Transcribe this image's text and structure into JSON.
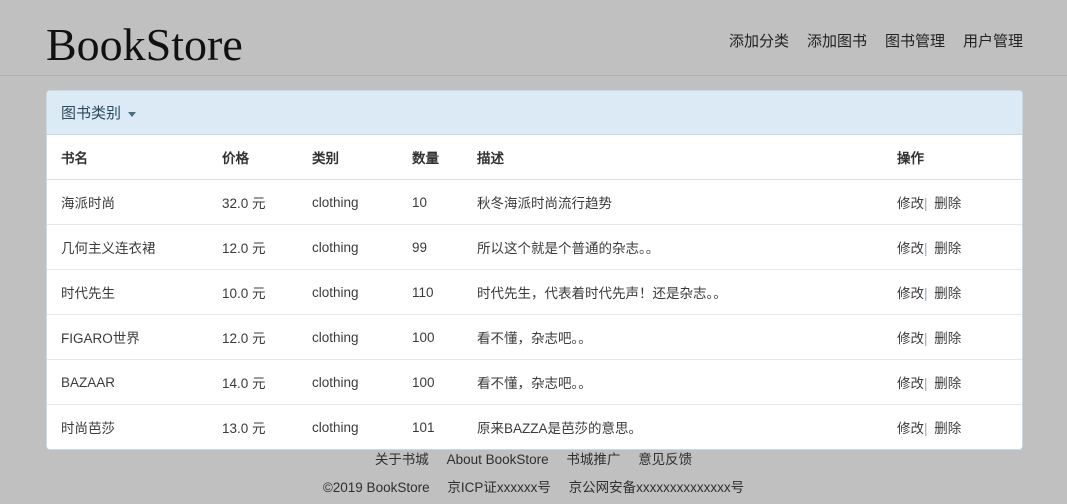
{
  "header": {
    "brand": "BookStore",
    "nav": [
      {
        "label": "添加分类",
        "name": "nav-add-category"
      },
      {
        "label": "添加图书",
        "name": "nav-add-book"
      },
      {
        "label": "图书管理",
        "name": "nav-book-admin"
      },
      {
        "label": "用户管理",
        "name": "nav-user-admin"
      }
    ]
  },
  "panel": {
    "title": "图书类别",
    "caret_icon": "chevron-down-icon",
    "accent_color": "#dbeaf4",
    "border_color": "#c6d9e4"
  },
  "table": {
    "columns": [
      "书名",
      "价格",
      "类别",
      "数量",
      "描述",
      "操作"
    ],
    "rows": [
      {
        "name": "海派时尚",
        "price": "32.0 元",
        "category": "clothing",
        "quantity": "10",
        "description": "秋冬海派时尚流行趋势",
        "edit": "修改",
        "delete": "删除"
      },
      {
        "name": "几何主义连衣裙",
        "price": "12.0 元",
        "category": "clothing",
        "quantity": "99",
        "description": "所以这个就是个普通的杂志。。",
        "edit": "修改",
        "delete": "删除"
      },
      {
        "name": "时代先生",
        "price": "10.0 元",
        "category": "clothing",
        "quantity": "110",
        "description": "时代先生，代表着时代先声！还是杂志。。",
        "edit": "修改",
        "delete": "删除"
      },
      {
        "name": "FIGARO世界",
        "price": "12.0 元",
        "category": "clothing",
        "quantity": "100",
        "description": "看不懂，杂志吧。。",
        "edit": "修改",
        "delete": "删除"
      },
      {
        "name": "BAZAAR",
        "price": "14.0 元",
        "category": "clothing",
        "quantity": "100",
        "description": "看不懂，杂志吧。。",
        "edit": "修改",
        "delete": "删除"
      },
      {
        "name": "时尚芭莎",
        "price": "13.0 元",
        "category": "clothing",
        "quantity": "101",
        "description": "原来BAZZA是芭莎的意思。",
        "edit": "修改",
        "delete": "删除"
      }
    ],
    "ops_separator": "|"
  },
  "footer": {
    "links": [
      {
        "label": "关于书城",
        "name": "footer-link-about-store"
      },
      {
        "label": "About BookStore",
        "name": "footer-link-about-bookstore"
      },
      {
        "label": "书城推广",
        "name": "footer-link-promotion"
      },
      {
        "label": "意见反馈",
        "name": "footer-link-feedback"
      }
    ],
    "copyright": "©2019 BookStore",
    "icp": "京ICP证xxxxxx号",
    "police": "京公网安备xxxxxxxxxxxxxx号"
  }
}
